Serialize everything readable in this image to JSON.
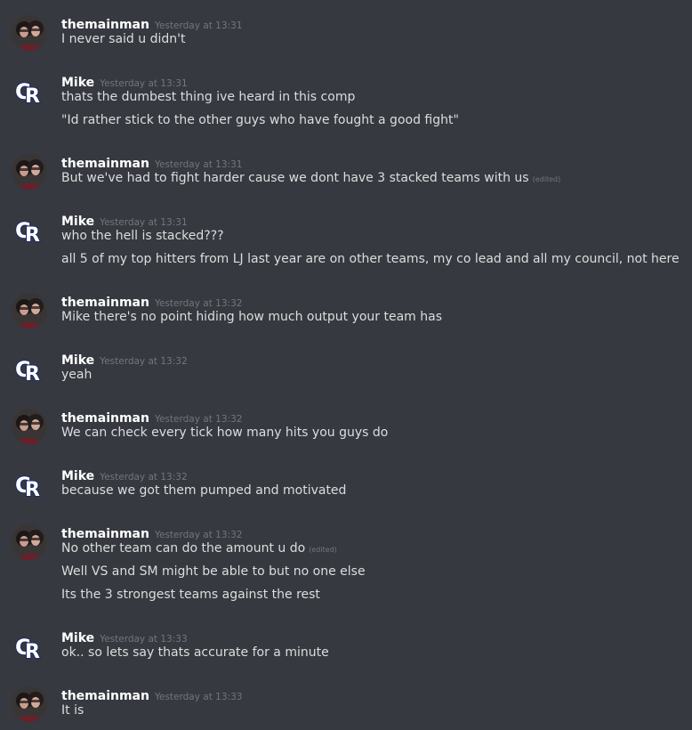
{
  "users": {
    "themainman": {
      "name": "themainman",
      "avatar_icon": "user-photo-avatar"
    },
    "mike": {
      "name": "Mike",
      "avatar_icon": "cr-logo-avatar",
      "avatar_color": "#1b2a6b"
    }
  },
  "edited_label": "(edited)",
  "messages": [
    {
      "author": "themainman",
      "time": "Yesterday at 13:31",
      "lines": [
        {
          "text": "I never said u didn't"
        }
      ]
    },
    {
      "author": "Mike",
      "time": "Yesterday at 13:31",
      "lines": [
        {
          "text": "thats the dumbest thing ive heard in this comp"
        },
        {
          "text": "\"Id rather stick to the other guys who have fought a good fight\""
        }
      ]
    },
    {
      "author": "themainman",
      "time": "Yesterday at 13:31",
      "lines": [
        {
          "text": "But we've had to fight harder cause we dont have 3 stacked teams with us",
          "edited": true
        }
      ]
    },
    {
      "author": "Mike",
      "time": "Yesterday at 13:31",
      "lines": [
        {
          "text": "who the hell is stacked???"
        },
        {
          "text": "all 5 of my top hitters from LJ last year are on other teams, my co lead and all my council, not here"
        }
      ]
    },
    {
      "author": "themainman",
      "time": "Yesterday at 13:32",
      "lines": [
        {
          "text": "Mike there's no point hiding how much output your team has"
        }
      ]
    },
    {
      "author": "Mike",
      "time": "Yesterday at 13:32",
      "lines": [
        {
          "text": "yeah"
        }
      ]
    },
    {
      "author": "themainman",
      "time": "Yesterday at 13:32",
      "lines": [
        {
          "text": "We can check every tick how many hits you guys do"
        }
      ]
    },
    {
      "author": "Mike",
      "time": "Yesterday at 13:32",
      "lines": [
        {
          "text": "because we got them pumped and motivated"
        }
      ]
    },
    {
      "author": "themainman",
      "time": "Yesterday at 13:32",
      "lines": [
        {
          "text": "No other team can do the amount u do",
          "edited": true
        },
        {
          "text": "Well VS and SM might be able to but no one else"
        },
        {
          "text": "Its the 3 strongest teams against the rest"
        }
      ]
    },
    {
      "author": "Mike",
      "time": "Yesterday at 13:33",
      "lines": [
        {
          "text": "ok.. so lets say thats accurate for a minute"
        }
      ]
    },
    {
      "author": "themainman",
      "time": "Yesterday at 13:33",
      "lines": [
        {
          "text": "It is"
        }
      ]
    }
  ]
}
